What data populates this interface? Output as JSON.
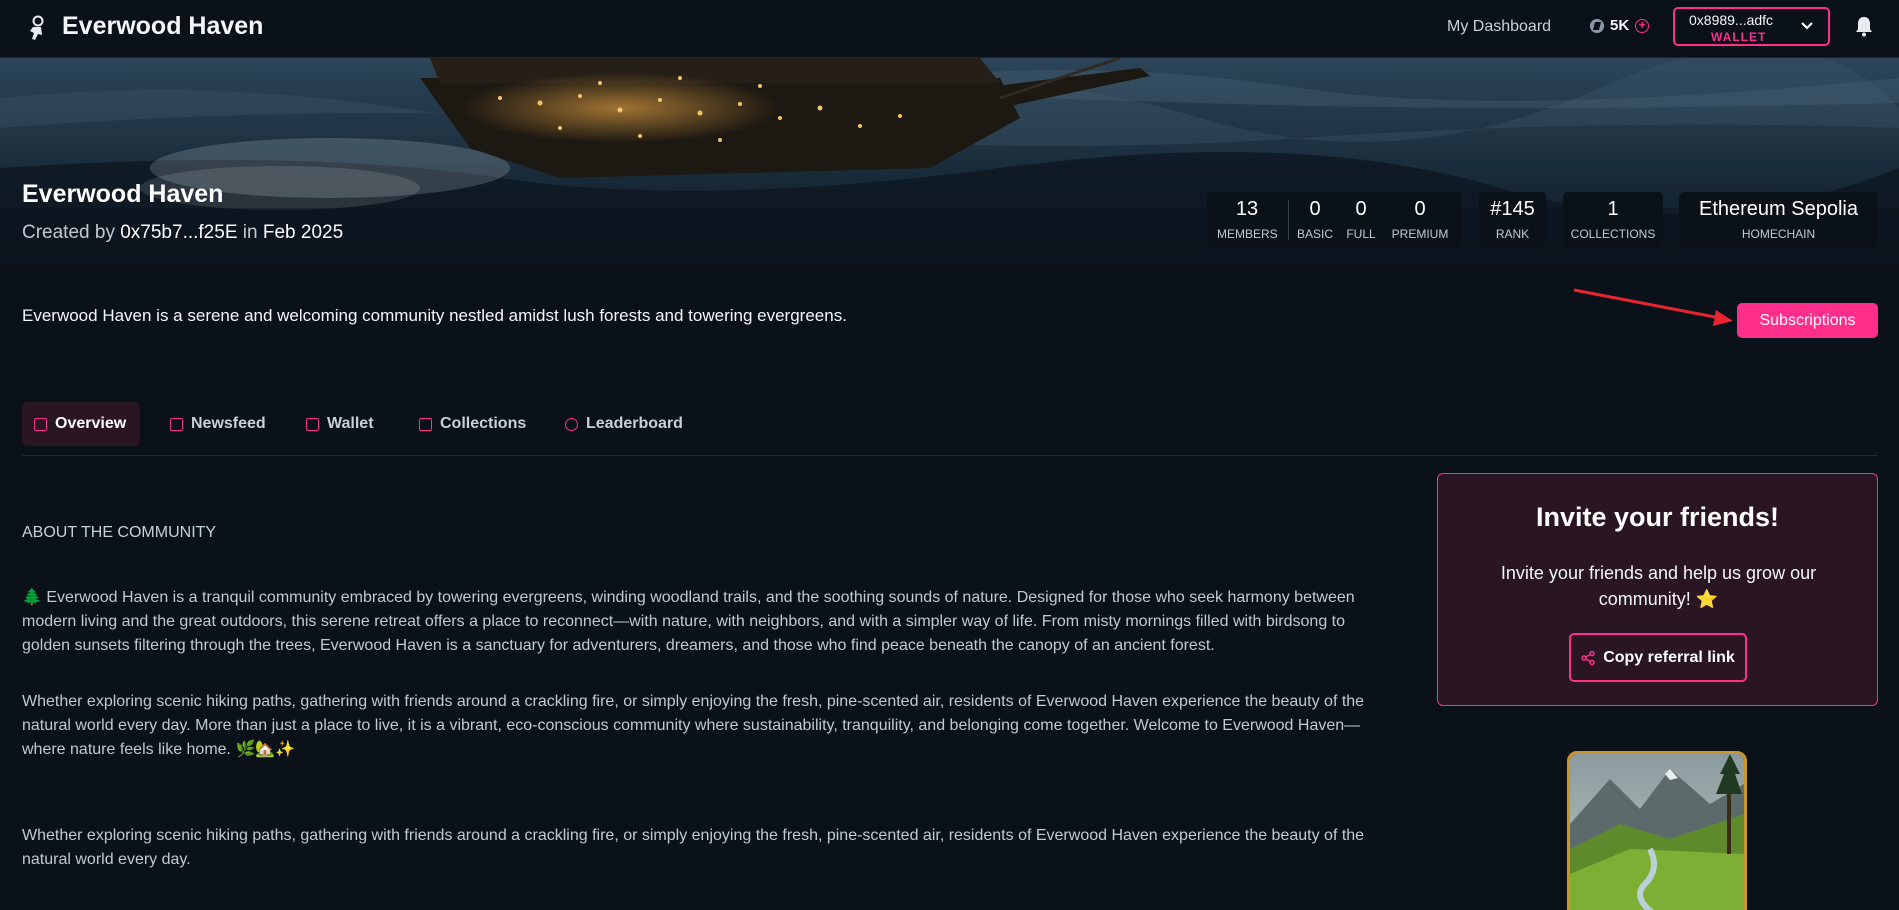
{
  "header": {
    "brand": "Everwood Haven",
    "nav_dashboard": "My Dashboard",
    "points": "5K",
    "wallet_address": "0x8989...adfc",
    "wallet_label": "WALLET"
  },
  "community": {
    "title": "Everwood Haven",
    "created_prefix": "Created by",
    "creator": "0x75b7...f25E",
    "created_in": "in",
    "created_date": "Feb 2025",
    "description": "Everwood Haven is a serene and welcoming community nestled amidst lush forests and towering evergreens.",
    "subscriptions_button": "Subscriptions"
  },
  "stats": {
    "members": {
      "value": "13",
      "label": "MEMBERS"
    },
    "basic": {
      "value": "0",
      "label": "BASIC"
    },
    "full": {
      "value": "0",
      "label": "FULL"
    },
    "premium": {
      "value": "0",
      "label": "PREMIUM"
    },
    "rank": {
      "value": "#145",
      "label": "RANK"
    },
    "collections": {
      "value": "1",
      "label": "COLLECTIONS"
    },
    "homechain": {
      "value": "Ethereum Sepolia",
      "label": "HOMECHAIN"
    }
  },
  "tabs": [
    {
      "label": "Overview",
      "icon": "overview-icon",
      "active": true
    },
    {
      "label": "Newsfeed",
      "icon": "newsfeed-icon"
    },
    {
      "label": "Wallet",
      "icon": "wallet-icon"
    },
    {
      "label": "Collections",
      "icon": "collections-icon"
    },
    {
      "label": "Leaderboard",
      "icon": "leaderboard-icon"
    }
  ],
  "about": {
    "heading": "ABOUT THE COMMUNITY",
    "paragraphs": [
      "🌲 Everwood Haven is a tranquil community embraced by towering evergreens, winding woodland trails, and the soothing sounds of nature. Designed for those who seek harmony between modern living and the great outdoors, this serene retreat offers a place to reconnect—with nature, with neighbors, and with a simpler way of life. From misty mornings filled with birdsong to golden sunsets filtering through the trees, Everwood Haven is a sanctuary for adventurers, dreamers, and those who find peace beneath the canopy of an ancient forest.",
      "Whether exploring scenic hiking paths, gathering with friends around a crackling fire, or simply enjoying the fresh, pine-scented air, residents of Everwood Haven experience the beauty of the natural world every day. More than just a place to live, it is a vibrant, eco-conscious community where sustainability, tranquility, and belonging come together. Welcome to Everwood Haven—where nature feels like home. 🌿🏡✨",
      "Whether exploring scenic hiking paths, gathering with friends around a crackling fire, or simply enjoying the fresh, pine-scented air, residents of Everwood Haven experience the beauty of the natural world every day."
    ]
  },
  "invite": {
    "title": "Invite your friends!",
    "text": "Invite your friends and help us grow our community! ⭐",
    "button": "Copy referral link"
  },
  "colors": {
    "accent": "#ff2e8a",
    "background": "#0b1119",
    "card_bg": "#2a1622",
    "nft_border": "#c9962e"
  }
}
